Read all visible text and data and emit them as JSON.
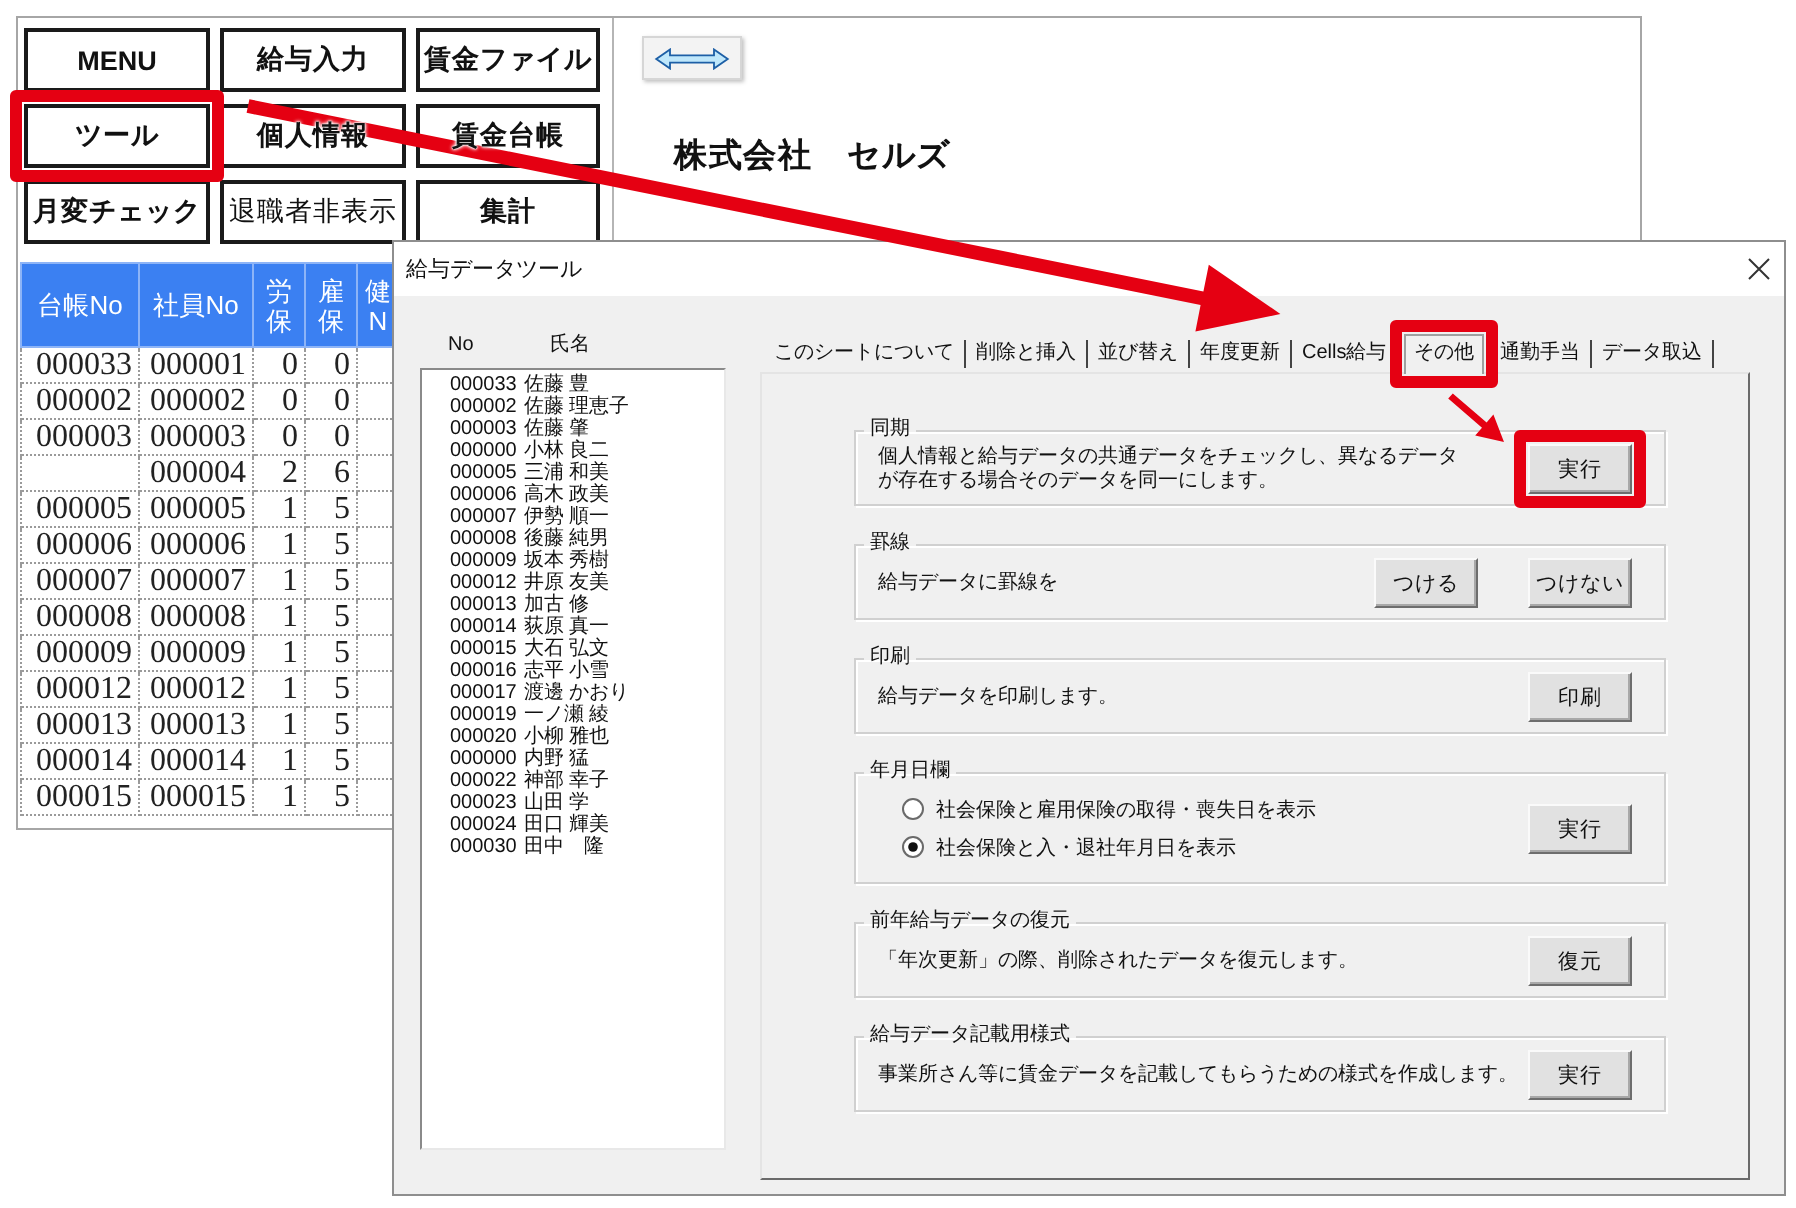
{
  "spreadsheet": {
    "menu_buttons": [
      {
        "label": "MENU",
        "kind": "nav",
        "highlighted": false
      },
      {
        "label": "給与入力",
        "kind": "nav",
        "highlighted": false
      },
      {
        "label": "賃金ファイル",
        "kind": "nav",
        "highlighted": false
      },
      {
        "label": "ツール",
        "kind": "nav",
        "highlighted": true
      },
      {
        "label": "個人情報",
        "kind": "nav",
        "highlighted": false
      },
      {
        "label": "賃金台帳",
        "kind": "nav",
        "highlighted": false
      },
      {
        "label": "月変チェック",
        "kind": "nav",
        "highlighted": false
      },
      {
        "label": "退職者非表示",
        "kind": "toggle",
        "highlighted": false
      },
      {
        "label": "集計",
        "kind": "nav",
        "highlighted": false
      }
    ],
    "company_name": "株式会社　セルズ",
    "table": {
      "columns": [
        "台帳No",
        "社員No",
        "労保",
        "雇保",
        "健N"
      ],
      "rows": [
        {
          "ledger_no": "000033",
          "employee_no": "000001",
          "labor_insurance": "0",
          "employment_insurance": "0"
        },
        {
          "ledger_no": "000002",
          "employee_no": "000002",
          "labor_insurance": "0",
          "employment_insurance": "0"
        },
        {
          "ledger_no": "000003",
          "employee_no": "000003",
          "labor_insurance": "0",
          "employment_insurance": "0"
        },
        {
          "employee_no": "000004",
          "labor_insurance": "2",
          "employment_insurance": "6"
        },
        {
          "ledger_no": "000005",
          "employee_no": "000005",
          "labor_insurance": "1",
          "employment_insurance": "5"
        },
        {
          "ledger_no": "000006",
          "employee_no": "000006",
          "labor_insurance": "1",
          "employment_insurance": "5"
        },
        {
          "ledger_no": "000007",
          "employee_no": "000007",
          "labor_insurance": "1",
          "employment_insurance": "5"
        },
        {
          "ledger_no": "000008",
          "employee_no": "000008",
          "labor_insurance": "1",
          "employment_insurance": "5"
        },
        {
          "ledger_no": "000009",
          "employee_no": "000009",
          "labor_insurance": "1",
          "employment_insurance": "5"
        },
        {
          "ledger_no": "000012",
          "employee_no": "000012",
          "labor_insurance": "1",
          "employment_insurance": "5"
        },
        {
          "ledger_no": "000013",
          "employee_no": "000013",
          "labor_insurance": "1",
          "employment_insurance": "5"
        },
        {
          "ledger_no": "000014",
          "employee_no": "000014",
          "labor_insurance": "1",
          "employment_insurance": "5"
        },
        {
          "ledger_no": "000015",
          "employee_no": "000015",
          "labor_insurance": "1",
          "employment_insurance": "5"
        }
      ]
    }
  },
  "dialog": {
    "title": "給与データツール",
    "list": {
      "columns": [
        "No",
        "氏名"
      ],
      "items": [
        {
          "no": "000033",
          "name": "佐藤 豊"
        },
        {
          "no": "000002",
          "name": "佐藤 理恵子"
        },
        {
          "no": "000003",
          "name": "佐藤 肇"
        },
        {
          "no": "000000",
          "name": "小林 良二"
        },
        {
          "no": "000005",
          "name": "三浦 和美"
        },
        {
          "no": "000006",
          "name": "高木 政美"
        },
        {
          "no": "000007",
          "name": "伊勢 順一"
        },
        {
          "no": "000008",
          "name": "後藤 純男"
        },
        {
          "no": "000009",
          "name": "坂本 秀樹"
        },
        {
          "no": "000012",
          "name": "井原 友美"
        },
        {
          "no": "000013",
          "name": "加古 修"
        },
        {
          "no": "000014",
          "name": "荻原 真一"
        },
        {
          "no": "000015",
          "name": "大石 弘文"
        },
        {
          "no": "000016",
          "name": "志平 小雪"
        },
        {
          "no": "000017",
          "name": "渡邊 かおり"
        },
        {
          "no": "000019",
          "name": "一ノ瀬 綾"
        },
        {
          "no": "000020",
          "name": "小柳 雅也"
        },
        {
          "no": "000000",
          "name": "内野 猛"
        },
        {
          "no": "000022",
          "name": "神部 幸子"
        },
        {
          "no": "000023",
          "name": "山田 学"
        },
        {
          "no": "000024",
          "name": "田口 輝美"
        },
        {
          "no": "000030",
          "name": "田中　隆"
        }
      ]
    },
    "tabs": [
      {
        "label": "このシートについて",
        "selected": false,
        "highlighted": false
      },
      {
        "label": "削除と挿入",
        "selected": false,
        "highlighted": false
      },
      {
        "label": "並び替え",
        "selected": false,
        "highlighted": false
      },
      {
        "label": "年度更新",
        "selected": false,
        "highlighted": false
      },
      {
        "label": "Cells給与",
        "selected": false,
        "highlighted": false
      },
      {
        "label": "その他",
        "selected": true,
        "highlighted": true
      },
      {
        "label": "通勤手当",
        "selected": false,
        "highlighted": false
      },
      {
        "label": "データ取込",
        "selected": false,
        "highlighted": false
      }
    ],
    "groups": [
      {
        "kind": "paragraph",
        "title": "同期",
        "text": "個人情報と給与データの共通データをチェックし、異なるデータが存在する場合そのデータを同一にします。",
        "buttons": [
          {
            "label": "実行",
            "highlighted": true
          }
        ]
      },
      {
        "kind": "text",
        "title": "罫線",
        "text": "給与データに罫線を",
        "buttons": [
          {
            "label": "つける",
            "highlighted": false
          },
          {
            "label": "つけない",
            "highlighted": false
          }
        ]
      },
      {
        "kind": "text",
        "title": "印刷",
        "text": "給与データを印刷します。",
        "buttons": [
          {
            "label": "印刷",
            "highlighted": false
          }
        ]
      },
      {
        "kind": "options",
        "title": "年月日欄",
        "options": [
          {
            "label": "社会保険と雇用保険の取得・喪失日を表示",
            "selected": false
          },
          {
            "label": "社会保険と入・退社年月日を表示",
            "selected": true
          }
        ],
        "buttons": [
          {
            "label": "実行",
            "highlighted": false
          }
        ]
      },
      {
        "kind": "text",
        "title": "前年給与データの復元",
        "text": "「年次更新」の際、削除されたデータを復元します。",
        "buttons": [
          {
            "label": "復元",
            "highlighted": false
          }
        ]
      },
      {
        "kind": "text",
        "title": "給与データ記載用様式",
        "text": "事業所さん等に賃金データを記載してもらうための様式を作成します。",
        "buttons": [
          {
            "label": "実行",
            "highlighted": false
          }
        ]
      }
    ]
  }
}
